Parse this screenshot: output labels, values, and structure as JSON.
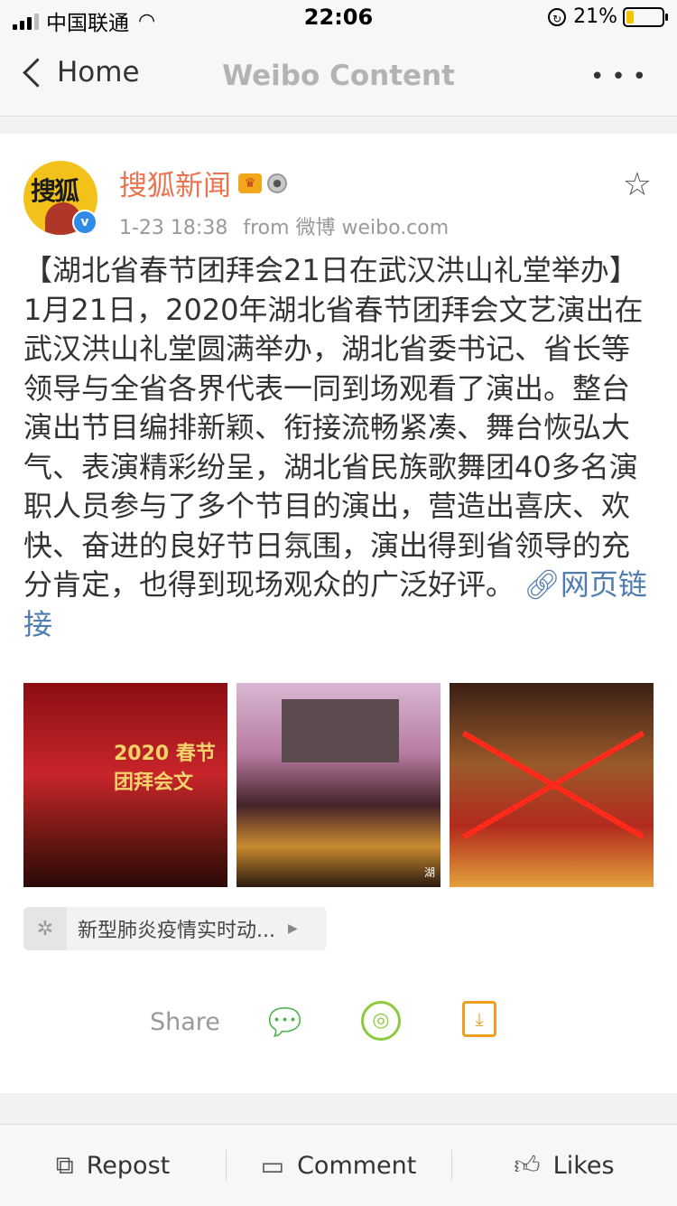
{
  "status_bar": {
    "carrier": "中国联通",
    "time": "22:06",
    "battery_percent": "21%",
    "battery_level": 0.21,
    "lock_icon": "↻"
  },
  "nav": {
    "back_label": "Home",
    "title": "Weibo Content",
    "more_label": "•••"
  },
  "post": {
    "author": "搜狐新闻",
    "avatar_text": "搜狐",
    "timestamp": "1-23 18:38",
    "source": "from 微博 weibo.com",
    "text": "【湖北省春节团拜会21日在武汉洪山礼堂举办】1月21日，2020年湖北省春节团拜会文艺演出在武汉洪山礼堂圆满举办，湖北省委书记、省长等领导与全省各界代表一同到场观看了演出。整台演出节目编排新颖、衔接流畅紧凑、舞台恢弘大气、表演精彩纷呈，湖北省民族歌舞团40多名演职人员参与了多个节目的演出，营造出喜庆、欢快、奋进的良好节日氛围，演出得到省领导的充分肯定，也得到现场观众的广泛好评。",
    "link_label": "网页链接",
    "image1_text": "2020 春节团拜会文",
    "watermark": "湖",
    "topic": "新型肺炎疫情实时动..."
  },
  "share": {
    "label": "Share"
  },
  "toolbar": {
    "repost": "Repost",
    "comment": "Comment",
    "likes": "Likes"
  },
  "icons": {
    "back": "chevron-left-icon",
    "more": "more-icon",
    "star": "star-outline-icon",
    "wechat": "wechat-icon",
    "moments": "moments-icon",
    "save": "save-image-icon",
    "repost": "repost-icon",
    "comment": "comment-icon",
    "likes": "thumbs-up-icon"
  },
  "colors": {
    "author": "#eb7350",
    "link": "#507daf",
    "wechat": "#49b24a",
    "moments": "#8ccc3c",
    "save": "#f0a020"
  }
}
